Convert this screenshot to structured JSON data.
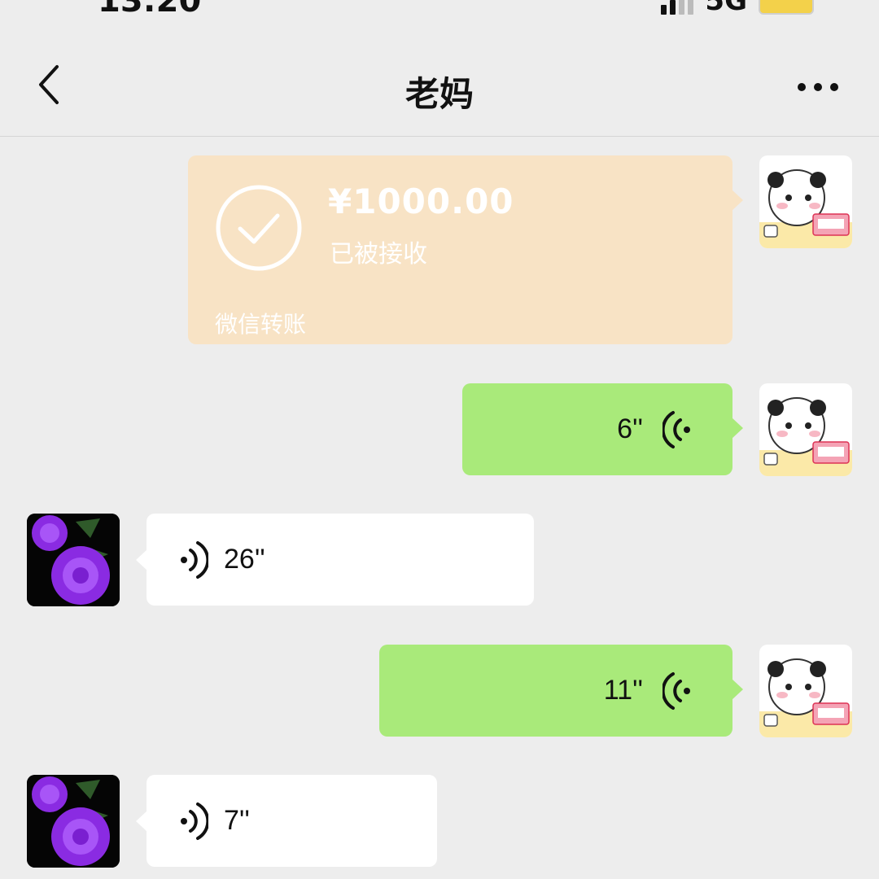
{
  "status_bar": {
    "time": "13:20",
    "network": "5G"
  },
  "header": {
    "title": "老妈"
  },
  "transfer": {
    "amount": "¥1000.00",
    "status": "已被接收",
    "brand": "微信转账"
  },
  "messages": [
    {
      "side": "me",
      "duration": "6''"
    },
    {
      "side": "mom",
      "duration": "26''"
    },
    {
      "side": "me",
      "duration": "11''"
    },
    {
      "side": "mom",
      "duration": "7''"
    }
  ],
  "colors": {
    "background": "#ededed",
    "sent_bubble": "#a9ea7a",
    "received_bubble": "#ffffff",
    "transfer_bubble": "#f8e3c5",
    "avatar_mom_flower": "#8a2be2"
  },
  "icons": {
    "back": "back-chevron-icon",
    "more": "more-dots-icon",
    "transfer_status": "check-circle-icon",
    "voice": "voice-wave-icon"
  }
}
